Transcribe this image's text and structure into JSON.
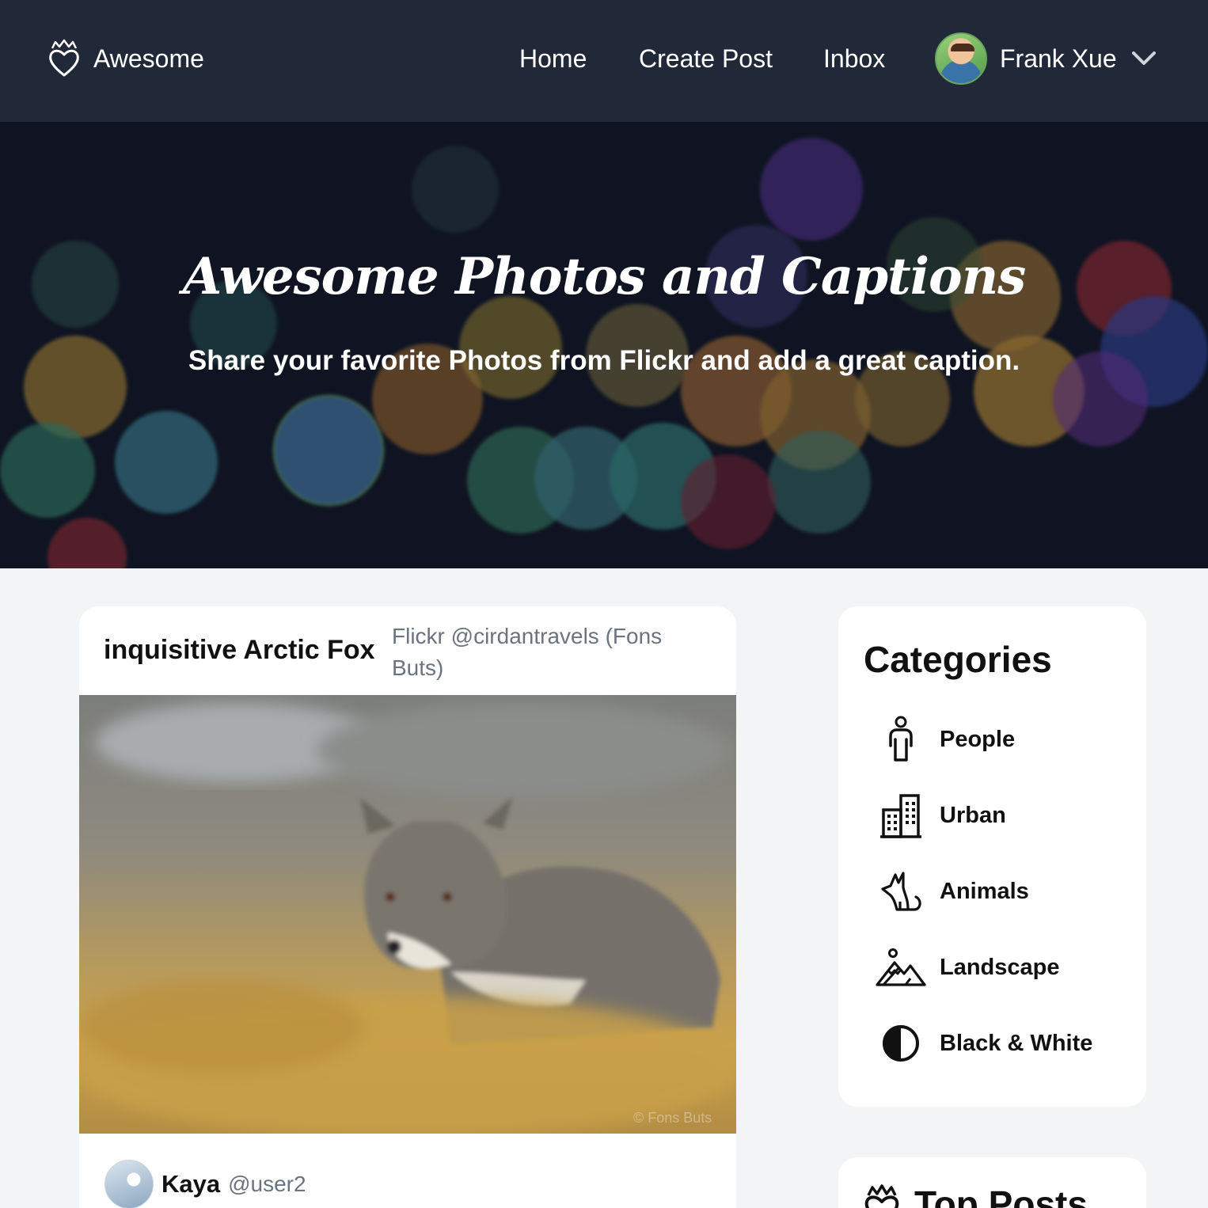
{
  "nav": {
    "brand": "Awesome",
    "links": {
      "home": "Home",
      "create_post": "Create Post",
      "inbox": "Inbox"
    },
    "user": {
      "name": "Frank Xue"
    }
  },
  "hero": {
    "title": "Awesome Photos and Captions",
    "subtitle": "Share your favorite Photos from Flickr and add a great caption."
  },
  "post": {
    "title": "inquisitive Arctic Fox",
    "source": "Flickr @cirdantravels (Fons Buts)",
    "watermark": "© Fons Buts",
    "author": {
      "name": "Kaya",
      "handle": "@user2"
    }
  },
  "categories": {
    "heading": "Categories",
    "items": [
      {
        "label": "People",
        "icon": "person-icon"
      },
      {
        "label": "Urban",
        "icon": "building-icon"
      },
      {
        "label": "Animals",
        "icon": "animal-icon"
      },
      {
        "label": "Landscape",
        "icon": "mountain-icon"
      },
      {
        "label": "Black & White",
        "icon": "contrast-icon"
      }
    ]
  },
  "top_posts": {
    "heading": "Top Posts"
  },
  "colors": {
    "navbar": "#212838",
    "page_bg": "#f3f4f6",
    "card_bg": "#ffffff",
    "muted_text": "#6b7280"
  }
}
